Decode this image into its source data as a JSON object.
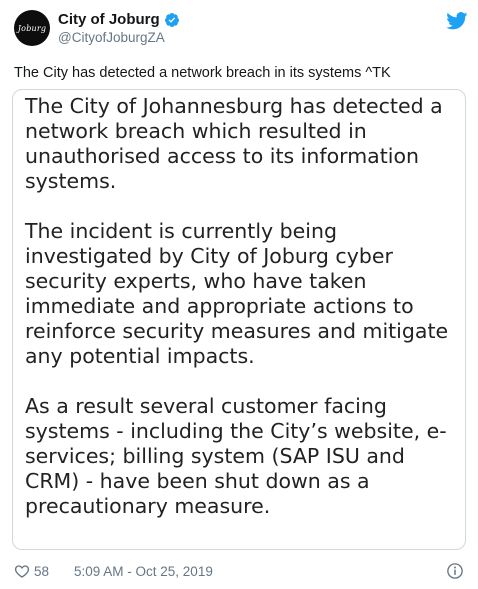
{
  "author": {
    "avatar_text": "Joburg",
    "display_name": "City of Joburg",
    "handle": "@CityofJoburgZA",
    "verified": true
  },
  "tweet": {
    "text": "The City has detected a network breach in its systems ^TK"
  },
  "image": {
    "paragraphs": [
      "The City of Johannesburg has detected a network breach which resulted in unauthorised access to its information systems.",
      "The incident is currently being investigated by City of Joburg cyber security experts, who have taken immediate and appropriate actions to reinforce security measures and mitigate any potential impacts.",
      "As a result several customer facing systems - including the City’s website, e-services; billing system (SAP ISU and CRM) - have been shut down as a precautionary measure."
    ]
  },
  "footer": {
    "like_count": "58",
    "timestamp": "5:09 AM - Oct 25, 2019"
  },
  "icons": {
    "bird": "twitter-bird-icon",
    "verified": "verified-badge-icon",
    "like": "heart-icon",
    "info": "info-icon"
  },
  "colors": {
    "twitter_blue": "#1da1f2",
    "secondary_text": "#657786",
    "border": "#cfd9de"
  }
}
